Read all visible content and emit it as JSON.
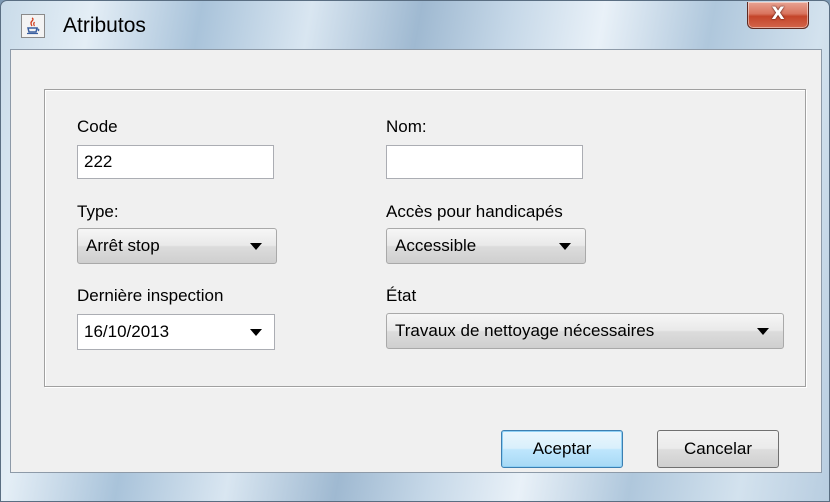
{
  "window": {
    "title": "Atributos",
    "close_label": "X"
  },
  "form": {
    "code": {
      "label": "Code",
      "value": "222"
    },
    "nom": {
      "label": "Nom:",
      "value": ""
    },
    "type": {
      "label": "Type:",
      "selected": "Arrêt stop"
    },
    "acces": {
      "label": "Accès pour handicapés",
      "selected": "Accessible"
    },
    "inspection": {
      "label": "Dernière inspection",
      "selected": "16/10/2013"
    },
    "etat": {
      "label": "État",
      "selected": "Travaux de nettoyage nécessaires"
    }
  },
  "buttons": {
    "accept": "Aceptar",
    "cancel": "Cancelar"
  },
  "icons": {
    "app": "java-cup-icon",
    "dropdown": "chevron-down-icon"
  },
  "colors": {
    "close_button": "#c4452a",
    "default_button_border": "#3c7fb1"
  }
}
